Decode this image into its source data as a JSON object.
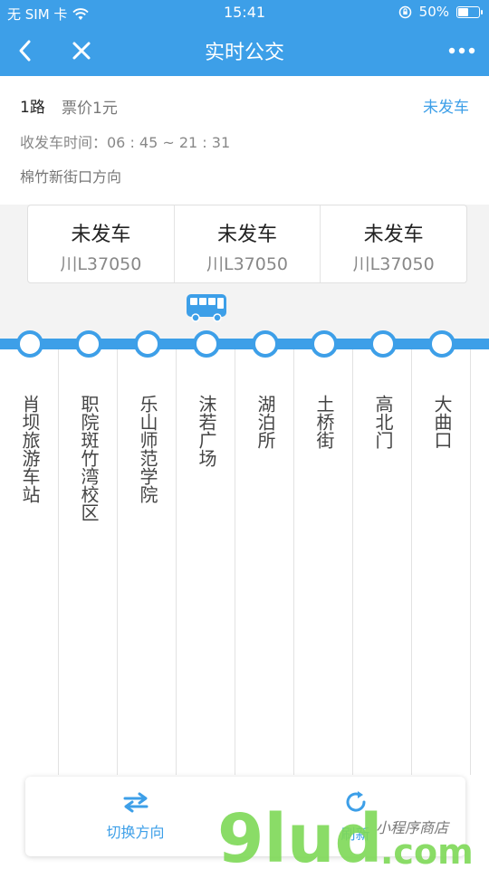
{
  "status_bar": {
    "carrier": "无 SIM 卡",
    "time": "15:41",
    "battery": "50%",
    "battery_level": 0.5
  },
  "nav": {
    "title": "实时公交",
    "back_icon": "back-chevron-icon",
    "close_icon": "close-icon",
    "more_icon": "more-dots-icon"
  },
  "route": {
    "line": "1路",
    "fare": "票价1元",
    "status": "未发车",
    "hours": "收发车时间：06 : 45 ~ 21 : 31",
    "direction": "棉竹新街口方向"
  },
  "vehicles": [
    {
      "status": "未发车",
      "plate": "川L37050"
    },
    {
      "status": "未发车",
      "plate": "川L37050"
    },
    {
      "status": "未发车",
      "plate": "川L37050"
    }
  ],
  "stops": [
    "肖坝旅游车站",
    "职院斑竹湾校区",
    "乐山师范学院",
    "沫若广场",
    "湖泊所",
    "土桥街",
    "高北门",
    "大曲口"
  ],
  "actions": {
    "switch_direction": "切换方向",
    "refresh": "刷新"
  },
  "watermark": {
    "logo": "9lud.com",
    "subtitle": "小程序商店"
  },
  "colors": {
    "brand": "#3d9fe8",
    "watermark_green": "#7ed957"
  }
}
